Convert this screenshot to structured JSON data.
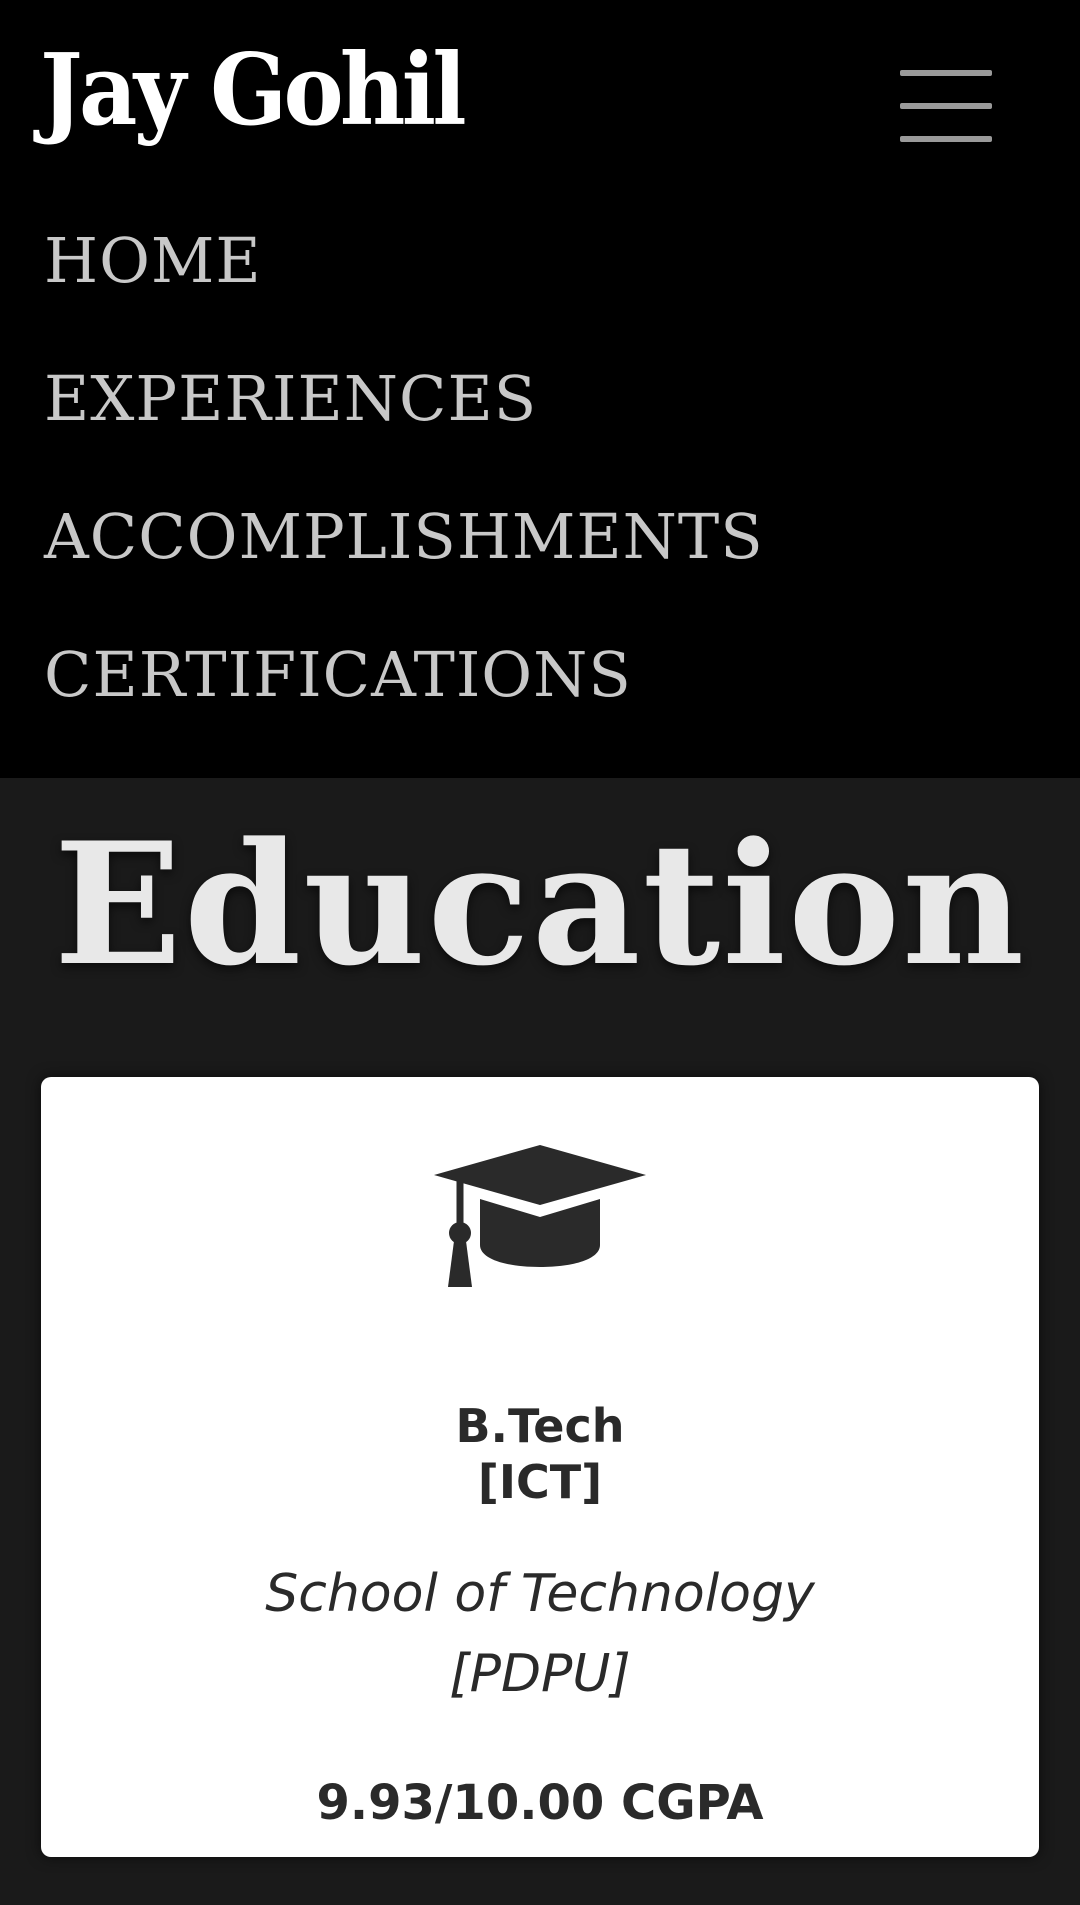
{
  "header": {
    "brand": "Jay Gohil",
    "menu_icon": "hamburger-menu-icon"
  },
  "nav": {
    "items": [
      {
        "label": "HOME"
      },
      {
        "label": "EXPERIENCES"
      },
      {
        "label": "ACCOMPLISHMENTS"
      },
      {
        "label": "CERTIFICATIONS"
      }
    ]
  },
  "education": {
    "title": "Education",
    "card": {
      "icon": "graduation-cap-icon",
      "degree_line1": "B.Tech",
      "degree_line2": "[ICT]",
      "school_line1": "School of Technology",
      "school_line2": "[PDPU]",
      "score": "9.93/10.00 CGPA"
    }
  },
  "colors": {
    "navbar_bg": "#000000",
    "page_bg": "#1a1a1a",
    "nav_text": "#c8c8c8",
    "card_bg": "#ffffff",
    "card_text": "#2a2a2a"
  }
}
